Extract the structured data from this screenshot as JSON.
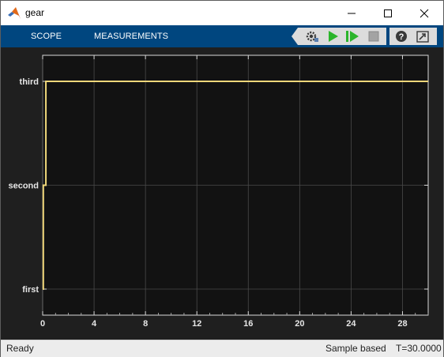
{
  "window": {
    "title": "gear",
    "minimize_icon": "minimize-icon",
    "maximize_icon": "maximize-icon",
    "close_icon": "close-icon"
  },
  "toolstrip": {
    "tabs": [
      {
        "label": "SCOPE"
      },
      {
        "label": "MEASUREMENTS"
      }
    ],
    "buttons": [
      {
        "icon": "settings-gear-icon"
      },
      {
        "icon": "run-icon"
      },
      {
        "icon": "step-forward-icon"
      },
      {
        "icon": "stop-icon"
      },
      {
        "icon": "help-icon"
      },
      {
        "icon": "undock-icon"
      }
    ],
    "colors": {
      "background": "#00467f",
      "run": "#2bb52b",
      "stop": "#a3a3a3"
    }
  },
  "status": {
    "state": "Ready",
    "mode": "Sample based",
    "time": "T=30.0000"
  },
  "chart_data": {
    "type": "line",
    "title": "",
    "xlabel": "",
    "ylabel": "",
    "xlim": [
      0,
      30
    ],
    "x_ticks": [
      "0",
      "4",
      "8",
      "12",
      "16",
      "20",
      "24",
      "28"
    ],
    "y_categories": [
      "first",
      "second",
      "third"
    ],
    "grid": true,
    "line_color": "#f0d77a",
    "background": "#121212",
    "series": [
      {
        "x": [
          0,
          0.05,
          0.05,
          0.25,
          0.25,
          30
        ],
        "y": [
          "first",
          "first",
          "second",
          "second",
          "third",
          "third"
        ]
      }
    ]
  }
}
